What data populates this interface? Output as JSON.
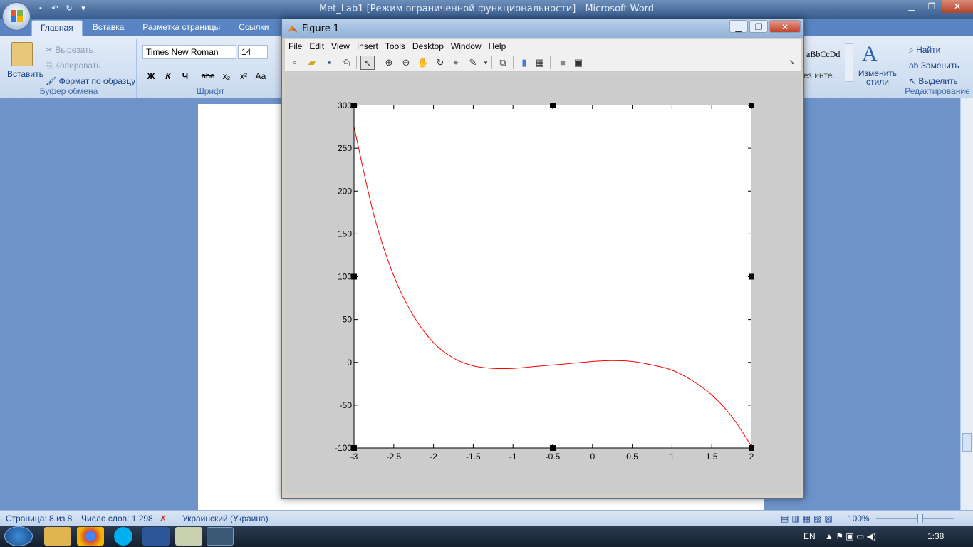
{
  "word": {
    "title": "Met_Lab1 [Режим ограниченной функциональности] - Microsoft Word",
    "tabs": [
      "Главная",
      "Вставка",
      "Разметка страницы",
      "Ссылки"
    ],
    "clipboard": {
      "paste": "Вставить",
      "cut": "Вырезать",
      "copy": "Копировать",
      "format_painter": "Формат по образцу",
      "group": "Буфер обмена"
    },
    "font": {
      "name": "Times New Roman",
      "size": "14",
      "group": "Шрифт",
      "bold": "Ж",
      "italic": "К",
      "underline": "Ч",
      "strike": "abe",
      "subscript": "x₂",
      "superscript": "x²",
      "case": "Aa"
    },
    "styles": {
      "preview": "aBbCcDd",
      "preview2": "ез инте...",
      "change": "Изменить стили"
    },
    "editing": {
      "find": "Найти",
      "replace": "Заменить",
      "select": "Выделить",
      "group": "Редактирование"
    },
    "status": {
      "page": "Страница: 8 из 8",
      "words": "Число слов: 1 298",
      "language": "Украинский (Украина)",
      "zoom": "100%"
    }
  },
  "taskbar": {
    "lang": "EN",
    "time": "1:38"
  },
  "figure": {
    "title": "Figure 1",
    "menu": [
      "File",
      "Edit",
      "View",
      "Insert",
      "Tools",
      "Desktop",
      "Window",
      "Help"
    ]
  },
  "chart_data": {
    "type": "line",
    "title": "",
    "xlabel": "",
    "ylabel": "",
    "xlim": [
      -3,
      2
    ],
    "ylim": [
      -100,
      300
    ],
    "xticks": [
      "-3",
      "-2.5",
      "-2",
      "-1.5",
      "-1",
      "-0.5",
      "0",
      "0.5",
      "1",
      "1.5",
      "2"
    ],
    "yticks": [
      "-100",
      "-50",
      "0",
      "50",
      "100",
      "150",
      "200",
      "250",
      "300"
    ],
    "grid": false,
    "series": [
      {
        "color": "#ff0000",
        "x": [
          -3,
          -2.75,
          -2.5,
          -2.25,
          -2,
          -1.75,
          -1.5,
          -1.25,
          -1,
          -0.75,
          -0.5,
          -0.25,
          0,
          0.25,
          0.5,
          0.75,
          1,
          1.25,
          1.5,
          1.75,
          2
        ],
        "y": [
          275,
          172,
          101,
          54,
          23,
          5,
          -4,
          -7,
          -7,
          -5,
          -3,
          -1,
          1,
          2,
          1,
          -3,
          -9,
          -21,
          -38,
          -63,
          -98
        ]
      }
    ]
  }
}
